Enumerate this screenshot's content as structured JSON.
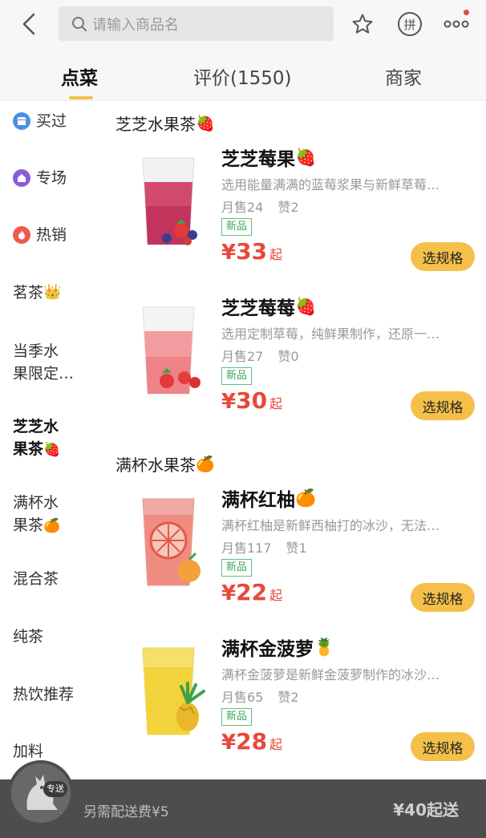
{
  "search": {
    "placeholder": "请输入商品名"
  },
  "header": {
    "icons": [
      "back-icon",
      "search-icon",
      "star-icon",
      "group-buy-icon",
      "more-icon"
    ],
    "group_buy_label": "拼"
  },
  "tabs": [
    {
      "label": "点菜",
      "active": true
    },
    {
      "label": "评价(1550)",
      "active": false
    },
    {
      "label": "商家",
      "active": false
    }
  ],
  "sidebar": {
    "items": [
      {
        "label": "买过",
        "icon": "shop-icon",
        "color": "#4a90e2"
      },
      {
        "label": "专场",
        "icon": "house-icon",
        "color": "#8a5cd8"
      },
      {
        "label": "热销",
        "icon": "flame-icon",
        "color": "#ef5a4a"
      },
      {
        "label": "茗茶",
        "emoji": "👑"
      },
      {
        "line1": "当季水",
        "line2": "果限定…"
      },
      {
        "line1": "芝芝水",
        "line2": "果茶",
        "emoji": "🍓",
        "active": true
      },
      {
        "line1": "满杯水",
        "line2": "果茶",
        "emoji": "🍊"
      },
      {
        "label": "混合茶"
      },
      {
        "label": "纯茶"
      },
      {
        "label": "热饮推荐"
      },
      {
        "label": "加料"
      }
    ]
  },
  "sections": [
    {
      "title": "芝芝水果茶",
      "emoji": "🍓",
      "items": [
        {
          "name": "芝芝莓果",
          "emoji": "🍓",
          "desc": "选用能量满满的蓝莓浆果与新鲜草莓…",
          "sales": "月售24",
          "likes": "赞2",
          "tag": "新品",
          "currency": "¥",
          "price": "33",
          "suffix": "起",
          "button": "选规格"
        },
        {
          "name": "芝芝莓莓",
          "emoji": "🍓",
          "desc": "选用定制草莓，纯鲜果制作，还原一…",
          "sales": "月售27",
          "likes": "赞0",
          "tag": "新品",
          "currency": "¥",
          "price": "30",
          "suffix": "起",
          "button": "选规格"
        }
      ]
    },
    {
      "title": "满杯水果茶",
      "emoji": "🍊",
      "items": [
        {
          "name": "满杯红柚",
          "emoji": "🍊",
          "desc": "满杯红柚是新鲜西柚打的冰沙，无法…",
          "sales": "月售117",
          "likes": "赞1",
          "tag": "新品",
          "currency": "¥",
          "price": "22",
          "suffix": "起",
          "button": "选规格"
        },
        {
          "name": "满杯金菠萝",
          "emoji": "🍍",
          "desc": "满杯金菠萝是新鲜金菠萝制作的冰沙…",
          "sales": "月售65",
          "likes": "赞2",
          "tag": "新品",
          "currency": "¥",
          "price": "28",
          "suffix": "起",
          "button": "选规格"
        }
      ]
    }
  ],
  "bottom": {
    "delivery_fee": "另需配送费¥5",
    "min_order": "¥40起送",
    "mascot_tag": "专送"
  },
  "colors": {
    "accent": "#f4c04a",
    "price": "#e8483b",
    "new_tag": "#36a85a"
  }
}
